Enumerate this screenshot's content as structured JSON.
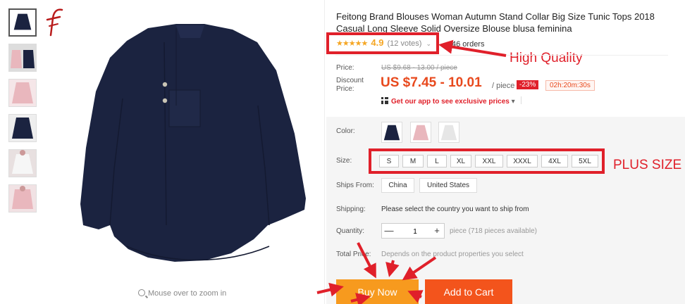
{
  "product": {
    "title": "Feitong Brand Blouses Woman Autumn Stand Collar Big Size Tunic Tops 2018 Casual Long Sleeve Solid Oversize Blouse blusa feminina",
    "stars": "★★★★★",
    "rating": "4.9",
    "votes": "(12 votes)",
    "chevron": "⌄",
    "orders": "46 orders"
  },
  "gallery": {
    "zoom_hint": "Mouse over to zoom in",
    "thumb_colors": [
      "#1b2340",
      "#e9b7bd",
      "#1b2340",
      "#e9b7bd",
      "#f2f2f2",
      "#e9b7bd"
    ]
  },
  "price": {
    "label": "Price:",
    "original": "US $9.68 - 13.00 / piece",
    "discount_label_1": "Discount",
    "discount_label_2": "Price:",
    "current": "US $7.45 - 10.01",
    "unit": "/ piece",
    "discount_badge": "-23%",
    "timer": "02h:20m:30s",
    "app_promo": "Get our app to see exclusive prices",
    "app_chevron": "▾"
  },
  "options": {
    "color_label": "Color:",
    "colors": [
      "#1b2340",
      "#e9b7bd",
      "#e6e6e6"
    ],
    "size_label": "Size:",
    "sizes": [
      "S",
      "M",
      "L",
      "XL",
      "XXL",
      "XXXL",
      "4XL",
      "5XL"
    ],
    "ships_from_label": "Ships From:",
    "ships_from": [
      "China",
      "United States"
    ],
    "shipping_label": "Shipping:",
    "shipping_text": "Please select the country you want to ship from",
    "quantity_label": "Quantity:",
    "quantity_value": "1",
    "minus": "—",
    "plus": "+",
    "quantity_note": "piece (718 pieces available)",
    "total_label": "Total Price:",
    "total_text": "Depends on the product properties you select"
  },
  "actions": {
    "buy_now": "Buy Now",
    "add_to_cart": "Add to Cart"
  },
  "annotations": {
    "high_quality": "High Quality",
    "plus_size": "PLUS SIZE"
  },
  "colors": {
    "accent": "#e8491d",
    "annotation_red": "#e0202a",
    "buy_now": "#f79a1e",
    "add_to_cart": "#f3541c",
    "garment_navy": "#1b2340"
  }
}
